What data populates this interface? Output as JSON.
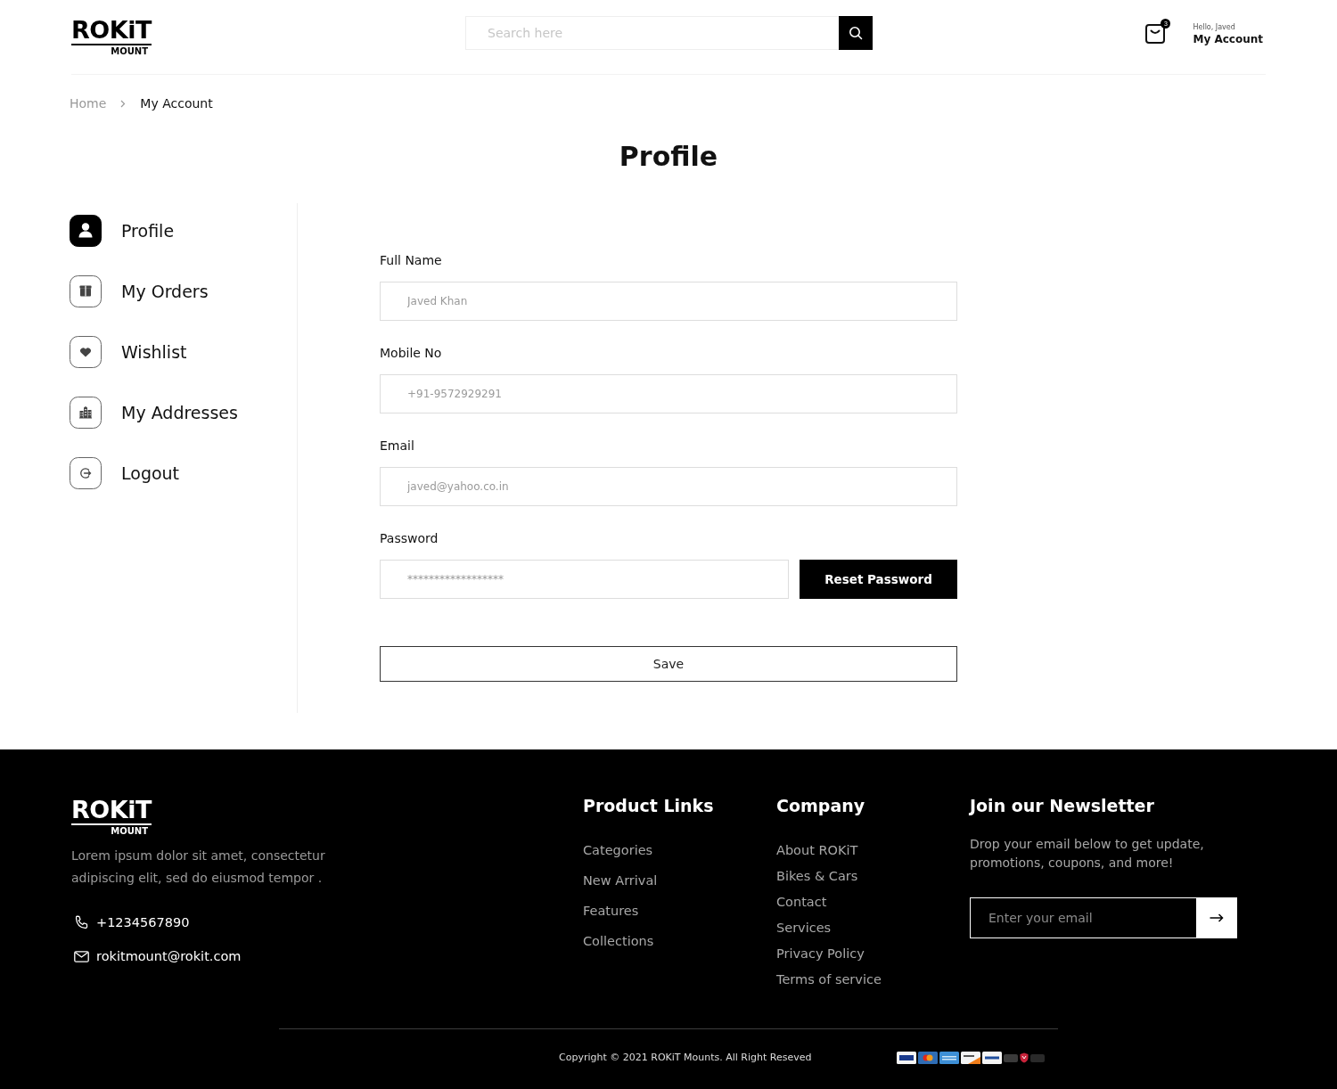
{
  "header": {
    "logo": {
      "wordmark": "ROKiT",
      "tagline": "MOUNT"
    },
    "search": {
      "placeholder": "Search here"
    },
    "cart": {
      "count": "3"
    },
    "account": {
      "greeting": "Hello, Javed",
      "label": "My Account"
    }
  },
  "breadcrumb": [
    {
      "label": "Home",
      "selected": false
    },
    {
      "label": "My Account",
      "selected": true
    }
  ],
  "page_title": "Profile",
  "sidebar": {
    "items": [
      {
        "kind": "user",
        "label": "Profile",
        "selected": true
      },
      {
        "kind": "box",
        "label": "My Orders",
        "selected": false
      },
      {
        "kind": "heart",
        "label": "Wishlist",
        "selected": false
      },
      {
        "kind": "building",
        "label": "My Addresses",
        "selected": false
      },
      {
        "kind": "logout",
        "label": "Logout",
        "selected": false
      }
    ]
  },
  "form": {
    "fields": [
      {
        "kind": "text",
        "label": "Full Name",
        "value": "Javed Khan"
      },
      {
        "kind": "text",
        "label": "Mobile No",
        "value": "+91-9572929291"
      },
      {
        "kind": "text",
        "label": "Email",
        "value": "javed@yahoo.co.in"
      },
      {
        "kind": "password",
        "label": "Password",
        "value": "******************",
        "button": "Reset Password"
      }
    ],
    "save": "Save"
  },
  "footer": {
    "logo": {
      "wordmark": "ROKiT",
      "tagline": "MOUNT"
    },
    "about": "Lorem ipsum dolor sit amet, consectetur adipiscing elit, sed do eiusmod tempor .",
    "contacts": [
      {
        "kind": "phone",
        "text": "+1234567890"
      },
      {
        "kind": "email",
        "text": "rokitmount@rokit.com"
      }
    ],
    "columns": [
      {
        "title": "Product Links",
        "links": [
          "Categories",
          "New Arrival",
          "Features",
          "Collections"
        ]
      },
      {
        "title": "Company",
        "links": [
          "About ROKiT",
          "Bikes & Cars",
          "Contact",
          "Services",
          "Privacy Policy",
          "Terms of service"
        ]
      }
    ],
    "newsletter": {
      "title": "Join our Newsletter",
      "text": "Drop your email below to get update, promotions, coupons, and more!",
      "placeholder": "Enter your email"
    },
    "copyright": "Copyright © 2021 ROKiT Mounts. All Right Reseved"
  }
}
